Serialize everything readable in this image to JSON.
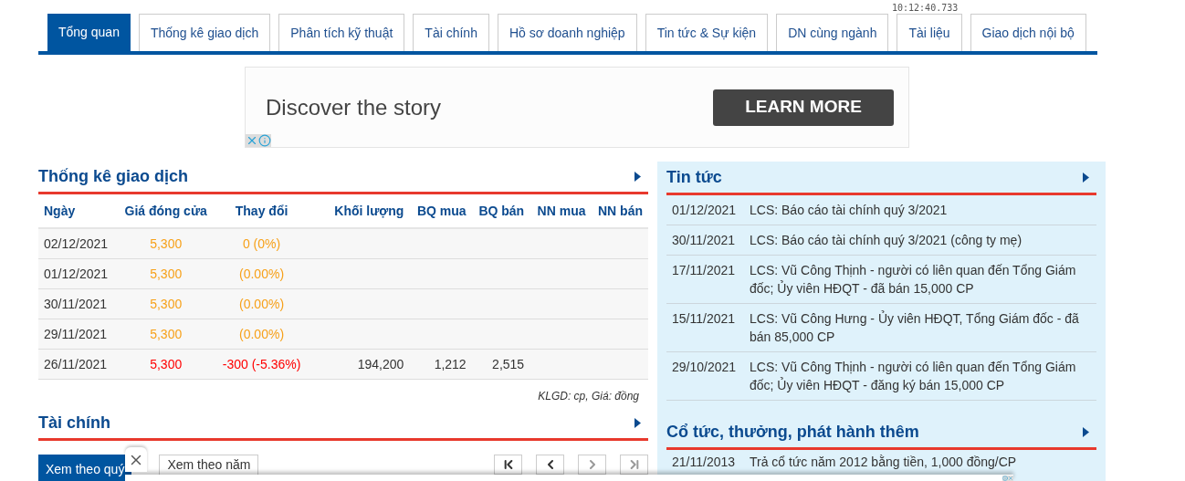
{
  "clock": "10:12:40.733",
  "tabs": [
    {
      "label": "Tổng quan",
      "selected": true
    },
    {
      "label": "Thống kê giao dịch",
      "selected": false
    },
    {
      "label": "Phân tích kỹ thuật",
      "selected": false
    },
    {
      "label": "Tài chính",
      "selected": false
    },
    {
      "label": "Hồ sơ doanh nghiệp",
      "selected": false
    },
    {
      "label": "Tin tức & Sự kiện",
      "selected": false
    },
    {
      "label": "DN cùng ngành",
      "selected": false
    },
    {
      "label": "Tài liệu",
      "selected": false
    },
    {
      "label": "Giao dịch nội bộ",
      "selected": false
    }
  ],
  "ad": {
    "headline": "Discover the story",
    "button": "LEARN MORE"
  },
  "trading": {
    "title": "Thống kê giao dịch",
    "columns": [
      "Ngày",
      "Giá đóng cửa",
      "Thay đổi",
      "Khối lượng",
      "BQ mua",
      "BQ bán",
      "NN mua",
      "NN bán"
    ],
    "rows": [
      {
        "kind": "ref",
        "date": "02/12/2021",
        "close": "5,300",
        "change": "0 (0%)"
      },
      {
        "kind": "ref",
        "date": "01/12/2021",
        "close": "5,300",
        "change": "(0.00%)"
      },
      {
        "kind": "ref",
        "date": "30/11/2021",
        "close": "5,300",
        "change": "(0.00%)"
      },
      {
        "kind": "ref",
        "date": "29/11/2021",
        "close": "5,300",
        "change": "(0.00%)"
      },
      {
        "kind": "down",
        "date": "26/11/2021",
        "close": "5,300",
        "change": "-300 (-5.36%)",
        "volume": "194,200",
        "bq_buy": "1,212",
        "bq_sell": "2,515"
      }
    ],
    "note": "KLGD: cp, Giá: đồng"
  },
  "finance": {
    "title": "Tài chính",
    "tabs": [
      {
        "label": "Xem theo quý",
        "selected": true
      },
      {
        "label": "Xem theo năm",
        "selected": false
      }
    ]
  },
  "news": {
    "title": "Tin tức",
    "items": [
      {
        "date": "01/12/2021",
        "text": "LCS: Báo cáo tài chính quý 3/2021"
      },
      {
        "date": "30/11/2021",
        "text": "LCS: Báo cáo tài chính quý 3/2021 (công ty mẹ)"
      },
      {
        "date": "17/11/2021",
        "text": "LCS: Vũ Công Thịnh - người có liên quan đến Tổng Giám đốc; Ủy viên HĐQT - đã bán 15,000 CP"
      },
      {
        "date": "15/11/2021",
        "text": "LCS: Vũ Công Hưng - Ủy viên HĐQT, Tổng Giám đốc - đã bán 85,000 CP"
      },
      {
        "date": "29/10/2021",
        "text": "LCS: Vũ Công Thịnh - người có liên quan đến Tổng Giám đốc; Ủy viên HĐQT - đăng ký bán 15,000 CP"
      }
    ]
  },
  "dividends": {
    "title": "Cổ tức, thưởng, phát hành thêm",
    "items": [
      {
        "date": "21/11/2013",
        "text": "Trả cổ tức năm 2012 bằng tiền, 1,000 đồng/CP"
      }
    ]
  }
}
